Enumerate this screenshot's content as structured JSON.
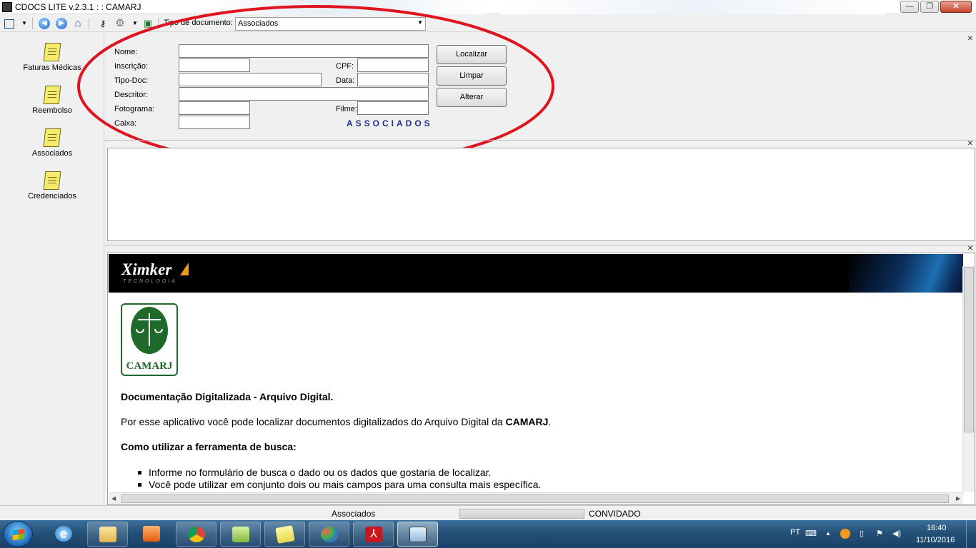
{
  "window": {
    "title": "CDOCS LITE v.2.3.1 : : CAMARJ",
    "minimize": "—",
    "maximize": "❐",
    "close": "✕"
  },
  "toolbar": {
    "doc_type_label": "Tipo de documento:",
    "doc_type_value": "Associados"
  },
  "sidebar": {
    "items": [
      {
        "label": "Faturas Médicas"
      },
      {
        "label": "Reembolso"
      },
      {
        "label": "Associados"
      },
      {
        "label": "Credenciados"
      }
    ]
  },
  "search_form": {
    "labels": {
      "nome": "Nome:",
      "inscricao": "Inscrição:",
      "cpf": "CPF:",
      "tipo_doc": "Tipo-Doc:",
      "data": "Data:",
      "descritor": "Descritor:",
      "fotograma": "Fotograma:",
      "filme": "Filme:",
      "caixa": "Caixa:"
    },
    "buttons": {
      "localizar": "Localizar",
      "limpar": "Limpar",
      "alterar": "Alterar"
    },
    "section_tag": "ASSOCIADOS"
  },
  "content": {
    "brand": "Ximker",
    "brand_sub": "TECNOLOGIA",
    "logo_text": "CAMARJ",
    "heading": "Documentação Digitalizada - Arquivo Digital.",
    "intro_prefix": "Por esse aplicativo você pode localizar documentos digitalizados do Arquivo Digital da ",
    "intro_bold": "CAMARJ",
    "intro_suffix": ".",
    "how_to_heading": "Como utilizar a ferramenta de busca:",
    "bullets": [
      "Informe no formulário de busca o dado ou os dados que gostaria de localizar.",
      "Você pode utilizar em conjunto dois ou mais campos para uma consulta mais específica."
    ]
  },
  "statusbar": {
    "left": "Associados",
    "right": "CONVIDADO"
  },
  "taskbar": {
    "language": "PT",
    "time": "16:40",
    "date": "11/10/2016"
  },
  "colors": {
    "annotation_circle": "#e0141e",
    "section_tag": "#1e2e8a",
    "logo_green": "#1f6a2b"
  }
}
